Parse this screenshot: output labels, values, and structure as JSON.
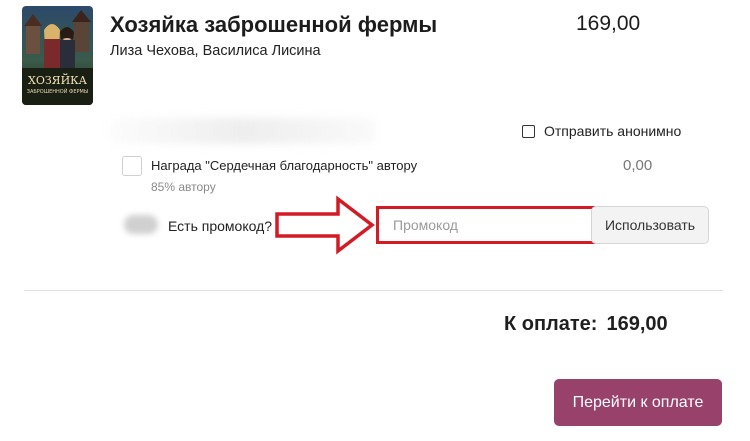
{
  "book": {
    "title": "Хозяйка заброшенной фермы",
    "authors": "Лиза Чехова, Василиса Лисина",
    "price": "169,00",
    "cover_title": "ХОЗЯЙКА",
    "cover_subtitle": "ЗАБРОШЕННОЙ ФЕРМЫ"
  },
  "anonymous": {
    "label": "Отправить анонимно",
    "checked": false
  },
  "reward": {
    "label": "Награда \"Сердечная благодарность\" автору",
    "share": "85% автору",
    "price": "0,00",
    "checked": false
  },
  "promo": {
    "question": "Есть промокод?",
    "placeholder": "Промокод",
    "value": "",
    "apply_label": "Использовать"
  },
  "total": {
    "label": "К оплате:",
    "amount": "169,00"
  },
  "checkout": {
    "button_label": "Перейти к оплате"
  },
  "colors": {
    "accent": "#98416b",
    "highlight": "#d31b24"
  }
}
